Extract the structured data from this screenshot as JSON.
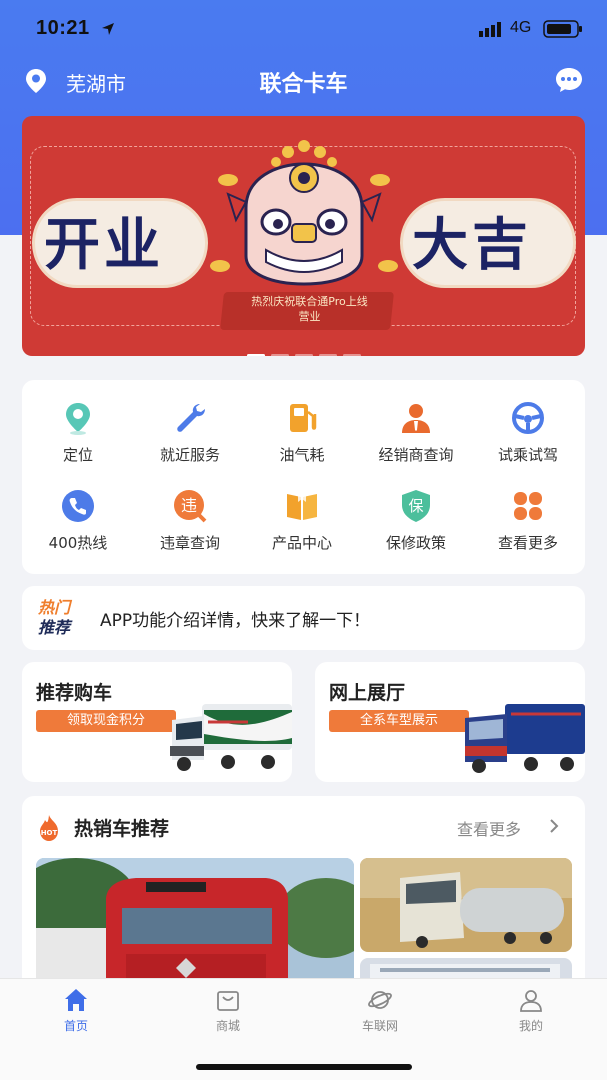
{
  "status_bar": {
    "time": "10:21",
    "network": "4G"
  },
  "header": {
    "city": "芜湖市",
    "title": "联合卡车"
  },
  "banner": {
    "left_text": "开业",
    "right_text": "大吉",
    "caption_line1": "热烈庆祝联合通Pro上线",
    "caption_line2": "营业",
    "colors": {
      "background": "#cf3a35",
      "text": "#1c2364"
    }
  },
  "services": [
    {
      "label": "定位",
      "icon": "location-pin-icon"
    },
    {
      "label": "就近服务",
      "icon": "wrench-icon"
    },
    {
      "label": "油气耗",
      "icon": "fuel-pump-icon"
    },
    {
      "label": "经销商查询",
      "icon": "dealer-person-icon"
    },
    {
      "label": "试乘试驾",
      "icon": "steering-wheel-icon"
    },
    {
      "label": "400热线",
      "icon": "phone-icon"
    },
    {
      "label": "违章查询",
      "icon": "violation-icon",
      "glyph": "违"
    },
    {
      "label": "产品中心",
      "icon": "book-icon"
    },
    {
      "label": "保修政策",
      "icon": "shield-icon",
      "glyph": "保"
    },
    {
      "label": "查看更多",
      "icon": "grid-more-icon"
    }
  ],
  "hot_notice": {
    "tag_line1": "热门",
    "tag_line2": "推荐",
    "text": "APP功能介绍详情，快来了解一下！"
  },
  "promos": [
    {
      "title": "推荐购车",
      "pill": "领取现金积分"
    },
    {
      "title": "网上展厅",
      "pill": "全系车型展示"
    }
  ],
  "hot_sales": {
    "title": "热销车推荐",
    "more_label": "查看更多",
    "badge": "HOT"
  },
  "tabs": [
    {
      "label": "首页",
      "active": true
    },
    {
      "label": "商城",
      "active": false
    },
    {
      "label": "车联网",
      "active": false
    },
    {
      "label": "我的",
      "active": false
    }
  ],
  "accent_color": "#3f6ee8"
}
